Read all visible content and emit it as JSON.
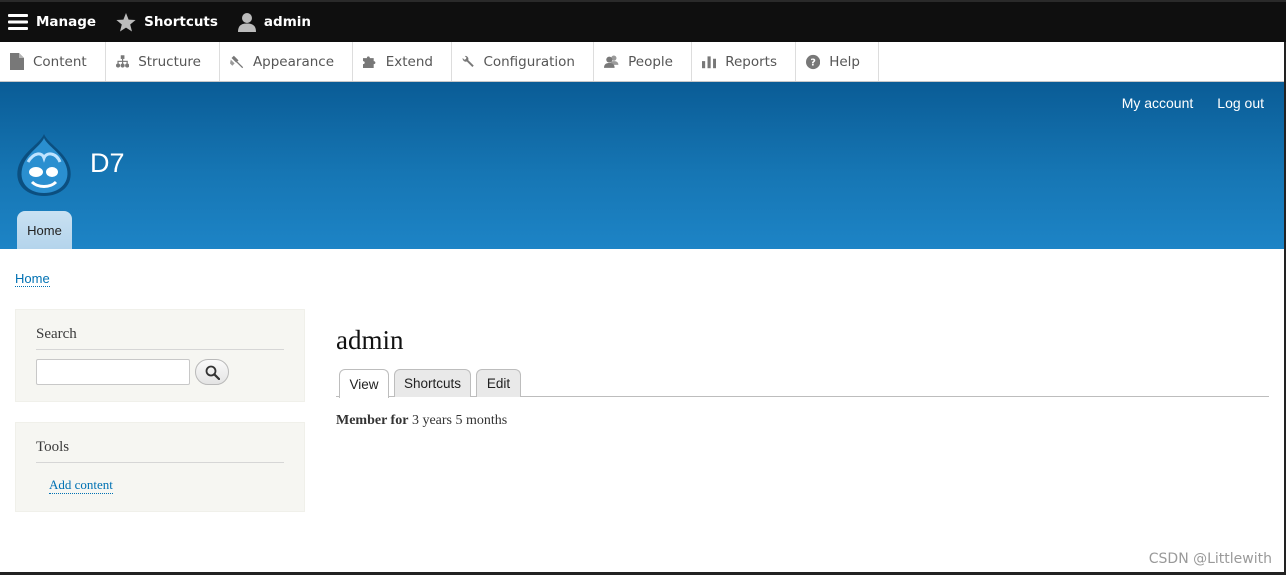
{
  "toolbar": {
    "manage": "Manage",
    "shortcuts": "Shortcuts",
    "user": "admin"
  },
  "tray": {
    "items": [
      {
        "label": "Content",
        "icon": "file-icon"
      },
      {
        "label": "Structure",
        "icon": "sitemap-icon"
      },
      {
        "label": "Appearance",
        "icon": "paintbrush-icon"
      },
      {
        "label": "Extend",
        "icon": "puzzle-icon"
      },
      {
        "label": "Configuration",
        "icon": "wrench-icon"
      },
      {
        "label": "People",
        "icon": "people-icon"
      },
      {
        "label": "Reports",
        "icon": "bar-chart-icon"
      },
      {
        "label": "Help",
        "icon": "help-icon"
      }
    ]
  },
  "header": {
    "secondary_menu": [
      "My account",
      "Log out"
    ],
    "site_name": "D7",
    "main_tab": "Home",
    "colors": {
      "gradient_top": "#0a5c96",
      "gradient_bottom": "#1d84c6"
    }
  },
  "breadcrumb": "Home",
  "sidebar": {
    "search_title": "Search",
    "search_value": "",
    "tools_title": "Tools",
    "tools_link": "Add content"
  },
  "main": {
    "title": "admin",
    "tabs": [
      "View",
      "Shortcuts",
      "Edit"
    ],
    "member_label": "Member for",
    "member_value": "3 years 5 months"
  },
  "watermark": "CSDN @Littlewith"
}
